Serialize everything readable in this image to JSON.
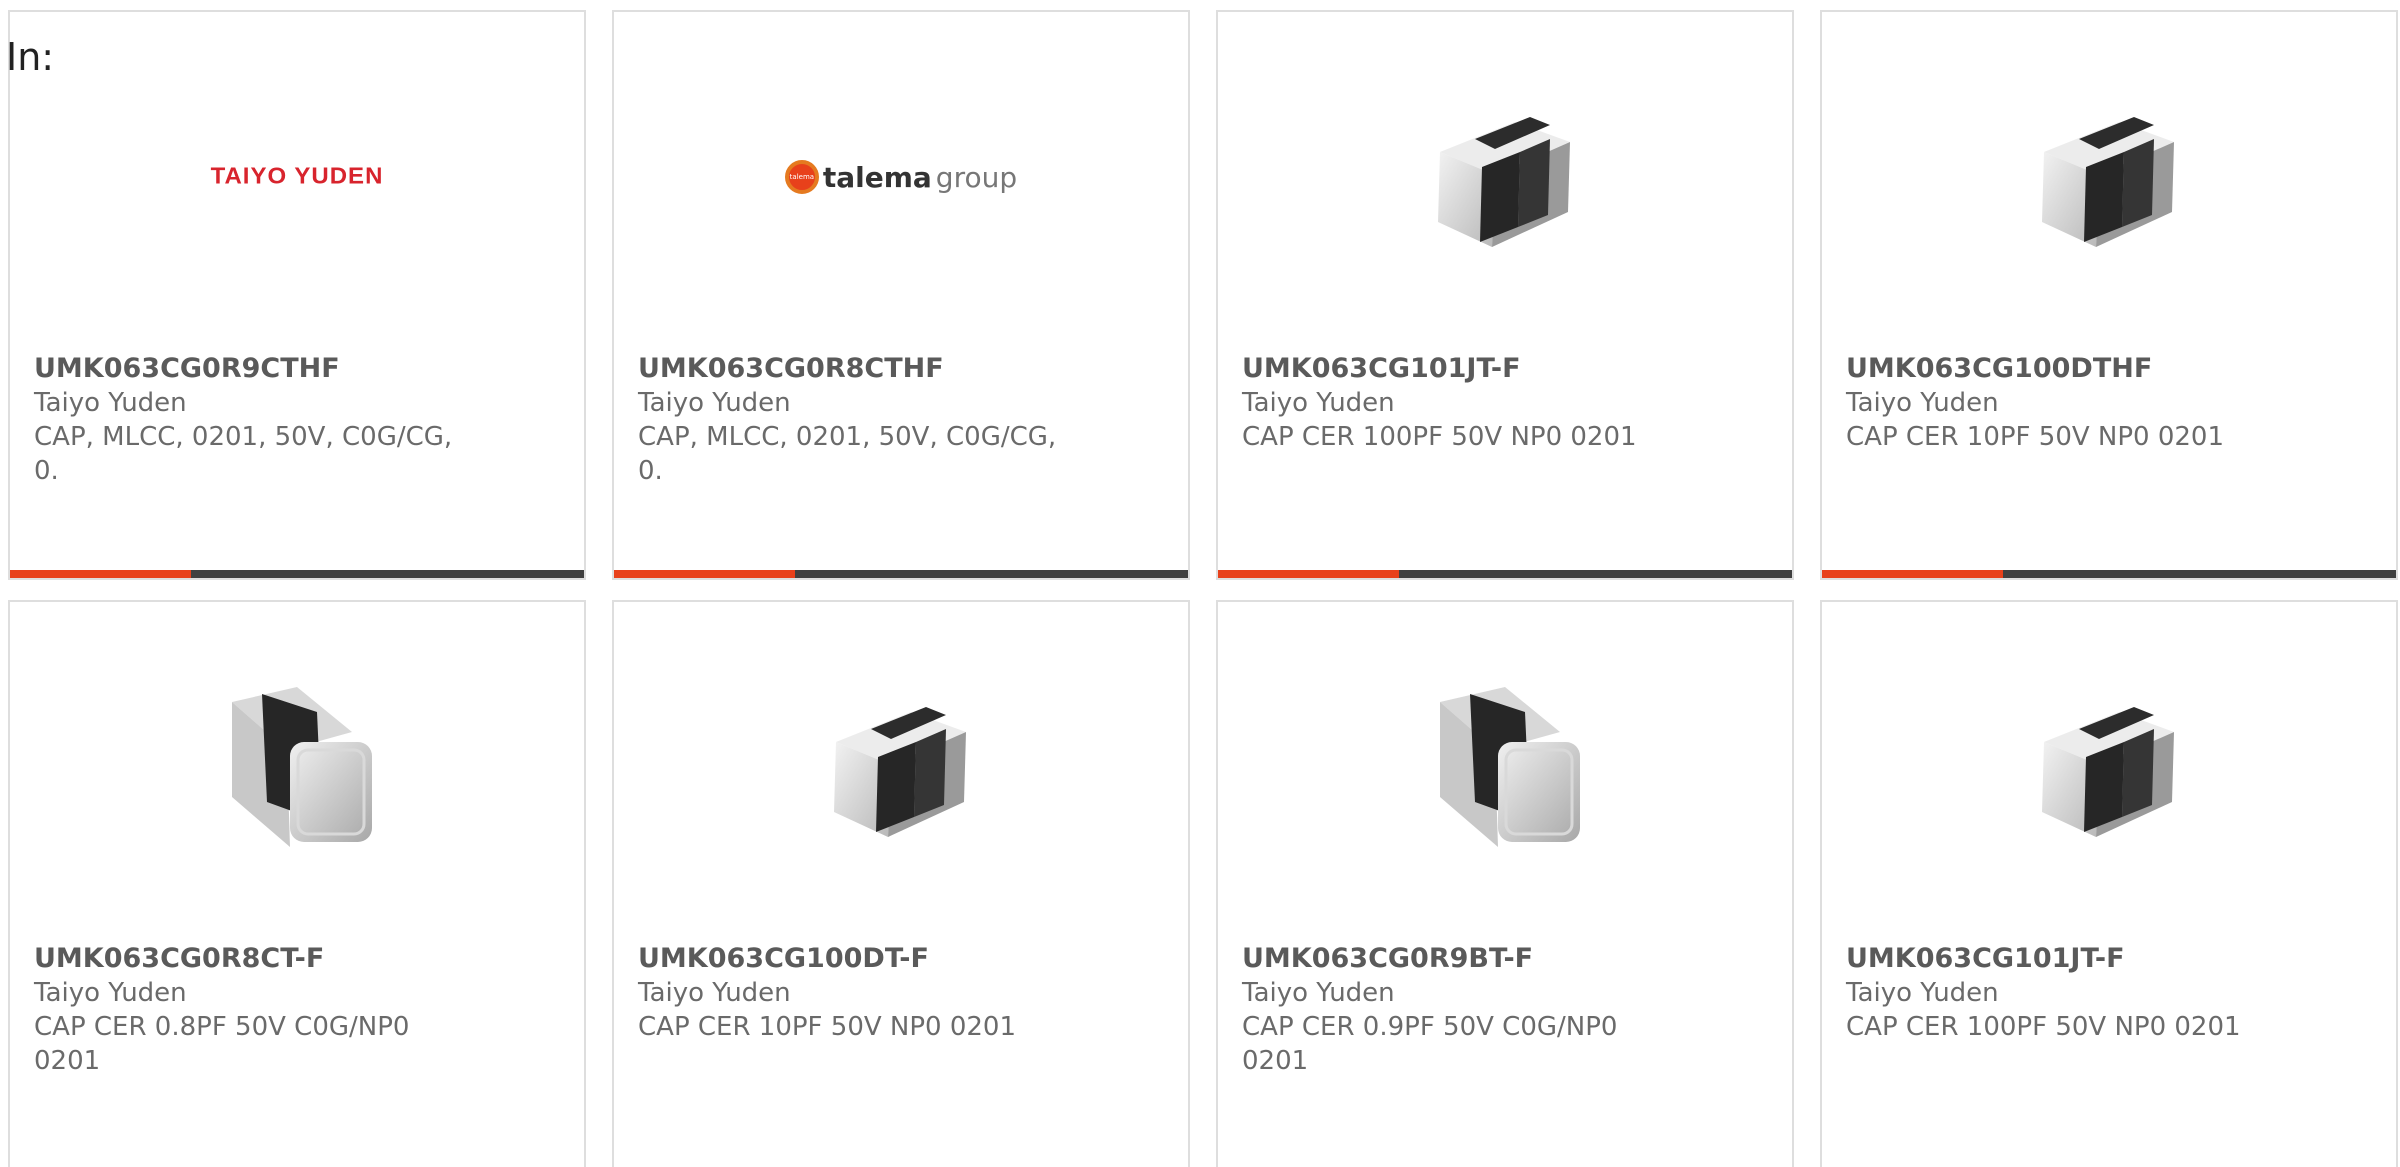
{
  "header": {
    "label": "In:"
  },
  "colors": {
    "accent": "#e8411b",
    "bar_dark": "#404040",
    "taiyo_red": "#d8242d",
    "talema_orange": "#e57a20"
  },
  "logos": {
    "taiyo": "TAIYO YUDEN",
    "talema_bold": "talema",
    "talema_light": "group",
    "talema_badge": "talema"
  },
  "cards": [
    {
      "image": "taiyo-yuden-logo",
      "part_number": "UMK063CG0R9CTHF",
      "manufacturer": "Taiyo Yuden",
      "description": "CAP, MLCC, 0201, 50V, C0G/CG, 0."
    },
    {
      "image": "talema-group-logo",
      "part_number": "UMK063CG0R8CTHF",
      "manufacturer": "Taiyo Yuden",
      "description": "CAP, MLCC, 0201, 50V, C0G/CG, 0."
    },
    {
      "image": "capacitor-chip-angled",
      "part_number": "UMK063CG101JT-F",
      "manufacturer": "Taiyo Yuden",
      "description": "CAP CER 100PF 50V NP0 0201"
    },
    {
      "image": "capacitor-chip-angled",
      "part_number": "UMK063CG100DTHF",
      "manufacturer": "Taiyo Yuden",
      "description": "CAP CER 10PF 50V NP0 0201"
    },
    {
      "image": "capacitor-chip-front",
      "part_number": "UMK063CG0R8CT-F",
      "manufacturer": "Taiyo Yuden",
      "description": "CAP CER 0.8PF 50V C0G/NP0 0201"
    },
    {
      "image": "capacitor-chip-angled",
      "part_number": "UMK063CG100DT-F",
      "manufacturer": "Taiyo Yuden",
      "description": "CAP CER 10PF 50V NP0 0201"
    },
    {
      "image": "capacitor-chip-front",
      "part_number": "UMK063CG0R9BT-F",
      "manufacturer": "Taiyo Yuden",
      "description": "CAP CER 0.9PF 50V C0G/NP0 0201"
    },
    {
      "image": "capacitor-chip-angled",
      "part_number": "UMK063CG101JT-F",
      "manufacturer": "Taiyo Yuden",
      "description": "CAP CER 100PF 50V NP0 0201"
    }
  ]
}
